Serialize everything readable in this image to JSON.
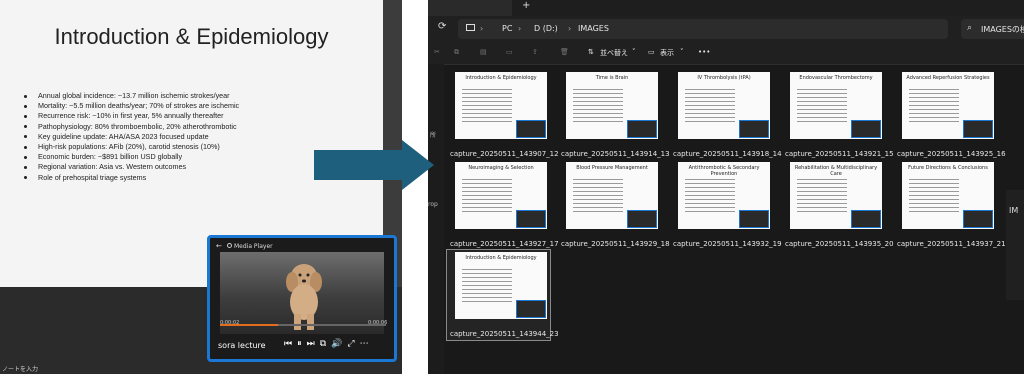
{
  "slide": {
    "title": "Introduction & Epidemiology",
    "bullets": [
      "Annual global incidence: ~13.7 million ischemic strokes/year",
      "Mortality: ~5.5 million deaths/year; 70% of strokes are ischemic",
      "Recurrence risk: ~10% in first year, 5% annually thereafter",
      "Pathophysiology: 80% thromboembolic, 20% atherothrombotic",
      "Key guideline update: AHA/ASA 2023 focused update",
      "High-risk populations: AFib (20%), carotid stenosis (10%)",
      "Economic burden: ~$891 billion USD globally",
      "Regional variation: Asia vs. Western outcomes",
      "Role of prehospital triage systems"
    ],
    "notes_placeholder": "ノートを入力"
  },
  "media_player": {
    "window_title": "Media Player",
    "media_name": "sora lecture",
    "time_elapsed": "0:00:02",
    "time_total": "0:00:06",
    "progress": 0.35,
    "controls": [
      "⏮",
      "⏸",
      "⏭",
      "⧉",
      "🔊",
      "⤢",
      "⋯"
    ]
  },
  "explorer": {
    "new_tab": "+",
    "breadcrumb": [
      "PC",
      "D (D:)",
      "IMAGES"
    ],
    "search_placeholder": "IMAGESの検",
    "toolbar": {
      "sort_label": "並べ替え",
      "view_label": "表示",
      "more": "•••"
    },
    "nav_labels": [
      "所",
      "rop"
    ],
    "preview_label": "IM",
    "files": [
      {
        "title": "Introduction & Epidemiology",
        "name": "capture_20250511_143907_12"
      },
      {
        "title": "Time is Brain",
        "name": "capture_20250511_143914_13"
      },
      {
        "title": "IV Thrombolysis (tPA)",
        "name": "capture_20250511_143918_14"
      },
      {
        "title": "Endovascular Thrombectomy",
        "name": "capture_20250511_143921_15"
      },
      {
        "title": "Advanced Reperfusion Strategies",
        "name": "capture_20250511_143925_16"
      },
      {
        "title": "Neuroimaging & Selection",
        "name": "capture_20250511_143927_17"
      },
      {
        "title": "Blood Pressure Management",
        "name": "capture_20250511_143929_18"
      },
      {
        "title": "Antithrombotic & Secondary Prevention",
        "name": "capture_20250511_143932_19"
      },
      {
        "title": "Rehabilitation & Multidisciplinary Care",
        "name": "capture_20250511_143935_20"
      },
      {
        "title": "Future Directions & Conclusions",
        "name": "capture_20250511_143937_21"
      },
      {
        "title": "Introduction & Epidemiology",
        "name": "capture_20250511_143944_23"
      }
    ]
  }
}
